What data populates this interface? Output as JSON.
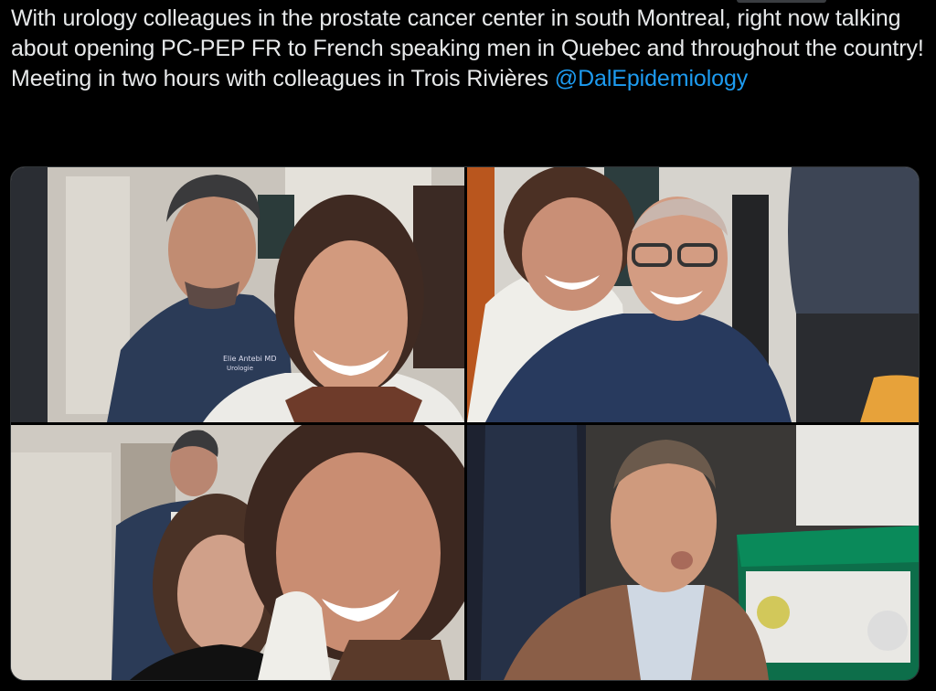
{
  "tweet": {
    "text": "With urology colleagues in the prostate cancer center in south Montreal, right now talking about opening PC-PEP FR to French speaking men in Quebec and throughout the country! Meeting in two hours with colleagues in Trois Rivières",
    "mention": "@DalEpidemiology",
    "mention_color": "#1d9bf0",
    "text_color": "#e7e9ea",
    "background": "#000000"
  },
  "media": {
    "photo_count": 4,
    "photos": [
      {
        "name": "selfie-with-urologist",
        "scrubs_label": "Elie Antebi MD\nUrologie"
      },
      {
        "name": "selfie-with-glasses-doctor"
      },
      {
        "name": "selfie-three-people"
      },
      {
        "name": "man-funny-face-portrait"
      }
    ]
  }
}
